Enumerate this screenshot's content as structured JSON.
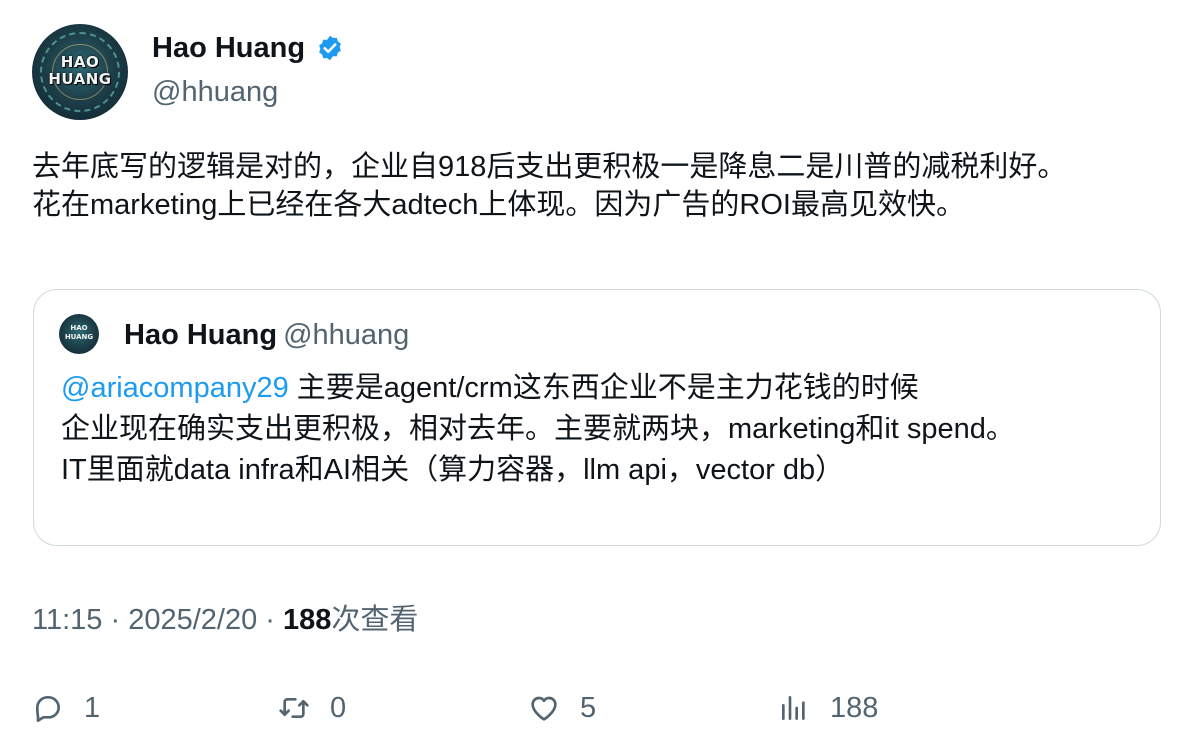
{
  "author": {
    "display_name": "Hao Huang",
    "handle": "@hhuang",
    "avatar_text": "HAO HUANG",
    "verified": true
  },
  "tweet": {
    "lines": [
      "去年底写的逻辑是对的，企业自918后支出更积极一是降息二是川普的减税利好。",
      "花在marketing上已经在各大adtech上体现。因为广告的ROI最高见效快。"
    ]
  },
  "quote": {
    "display_name": "Hao Huang",
    "handle": "@hhuang",
    "mention": "@ariacompany29",
    "line1_rest": " 主要是agent/crm这东西企业不是主力花钱的时候",
    "line2": "企业现在确实支出更积极，相对去年。主要就两块，marketing和it spend。",
    "line3": "IT里面就data infra和AI相关（算力容器，llm api，vector db）"
  },
  "meta": {
    "time": "11:15",
    "separator": "·",
    "date": "2025/2/20",
    "views_count": "188",
    "views_label": "次查看"
  },
  "actions": {
    "replies": "1",
    "retweets": "0",
    "likes": "5",
    "views": "188"
  },
  "icons": {
    "verified": "verified-badge-icon",
    "reply": "reply-icon",
    "retweet": "retweet-icon",
    "like": "heart-icon",
    "views": "views-chart-icon"
  },
  "colors": {
    "text": "#0f1419",
    "secondary": "#536471",
    "accent": "#1d9bf0",
    "border": "#cfd9de"
  }
}
